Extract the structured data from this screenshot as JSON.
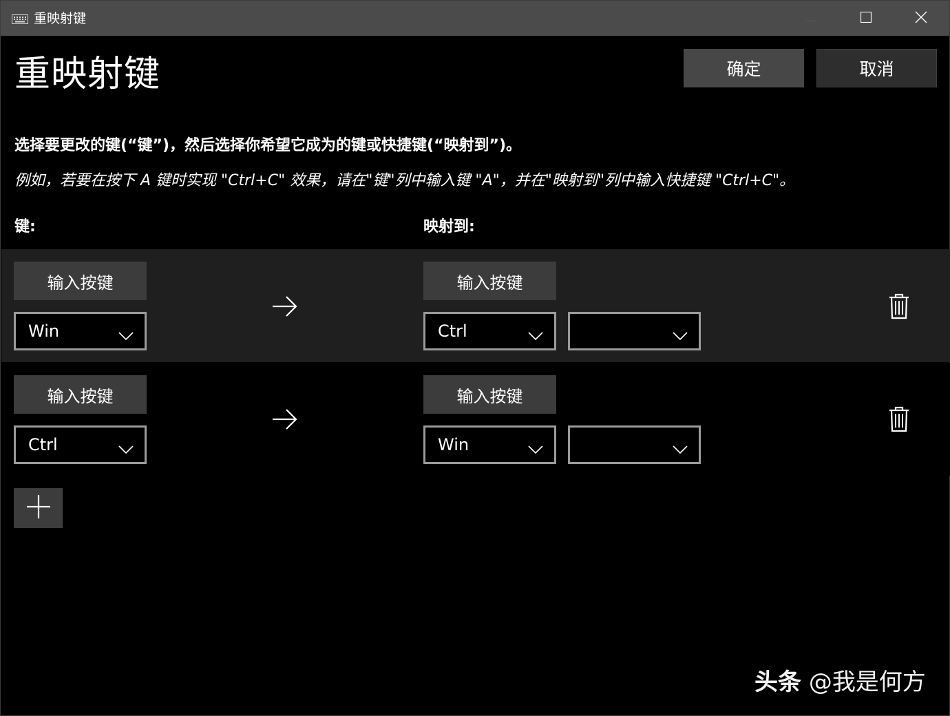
{
  "window": {
    "title": "重映射键",
    "controls": {
      "minimize_icon": "minimize-icon",
      "maximize_icon": "maximize-icon",
      "close_icon": "close-icon"
    }
  },
  "header": {
    "title": "重映射键",
    "ok_label": "确定",
    "cancel_label": "取消"
  },
  "instructions": {
    "main": "选择要更改的键(“键”)，然后选择你希望它成为的键或快捷键(“映射到”)。",
    "example": "例如，若要在按下 A 键时实现 \"Ctrl+C\" 效果，请在\"键\"列中输入键 \"A\"，并在\"映射到\"列中输入快捷键 \"Ctrl+C\"。"
  },
  "columns": {
    "key": "键:",
    "mapped_to": "映射到:"
  },
  "rows": [
    {
      "key_button": "输入按键",
      "key_value": "Win",
      "map_button": "输入按键",
      "map_value_1": "Ctrl",
      "map_value_2": ""
    },
    {
      "key_button": "输入按键",
      "key_value": "Ctrl",
      "map_button": "输入按键",
      "map_value_1": "Win",
      "map_value_2": ""
    }
  ],
  "add_button_icon": "plus-icon",
  "watermark": {
    "brand": "头条",
    "handle": "@我是何方"
  },
  "colors": {
    "background": "#000000",
    "titlebar": "#4b4b4b",
    "button": "#3c3c3c",
    "highlight_row": "#1f1f1f",
    "combo_border": "#9a9a9a"
  }
}
